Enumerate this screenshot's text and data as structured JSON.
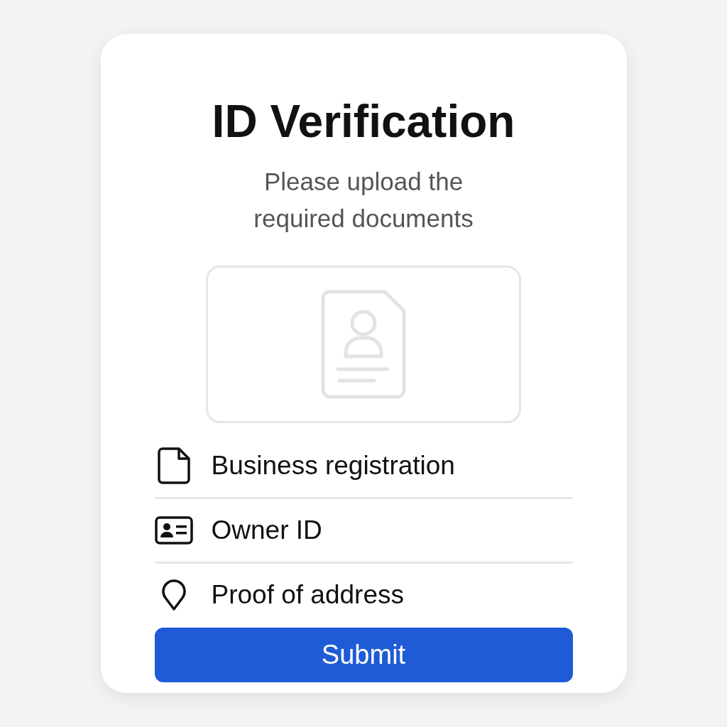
{
  "title": "ID Verification",
  "subtitle": "Please upload the required documents",
  "upload": {
    "kind": "id-document"
  },
  "documents": [
    {
      "kind": "document",
      "label": "Business registration"
    },
    {
      "kind": "id-card",
      "label": "Owner ID"
    },
    {
      "kind": "pin",
      "label": "Proof of address"
    }
  ],
  "submit": "Submit"
}
